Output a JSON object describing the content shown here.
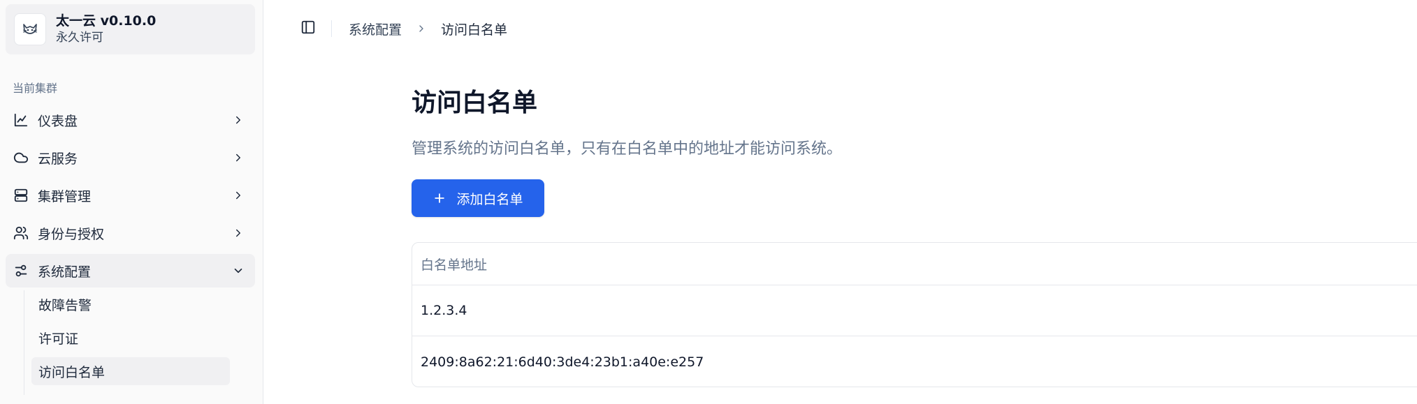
{
  "brand": {
    "title": "太一云 v0.10.0",
    "subtitle": "永久许可",
    "logo_icon": "cat-logo-icon"
  },
  "sidebar": {
    "group_label": "当前集群",
    "items": [
      {
        "label": "仪表盘",
        "icon": "chart-line-icon",
        "expanded": false
      },
      {
        "label": "云服务",
        "icon": "cloud-icon",
        "expanded": false
      },
      {
        "label": "集群管理",
        "icon": "server-icon",
        "expanded": false
      },
      {
        "label": "身份与授权",
        "icon": "users-icon",
        "expanded": false
      },
      {
        "label": "系统配置",
        "icon": "sliders-icon",
        "expanded": true
      }
    ],
    "sub_items": [
      {
        "label": "故障告警",
        "active": false
      },
      {
        "label": "许可证",
        "active": false
      },
      {
        "label": "访问白名单",
        "active": true
      }
    ]
  },
  "breadcrumb": {
    "parent": "系统配置",
    "current": "访问白名单"
  },
  "page": {
    "title": "访问白名单",
    "description": "管理系统的访问白名单，只有在白名单中的地址才能访问系统。",
    "add_button_label": "添加白名单"
  },
  "table": {
    "header": "白名单地址",
    "rows": [
      "1.2.3.4",
      "2409:8a62:21:6d40:3de4:23b1:a40e:e257"
    ]
  },
  "colors": {
    "accent": "#2563eb",
    "sidebar_bg": "#fafafa",
    "muted_text": "#64748b"
  }
}
